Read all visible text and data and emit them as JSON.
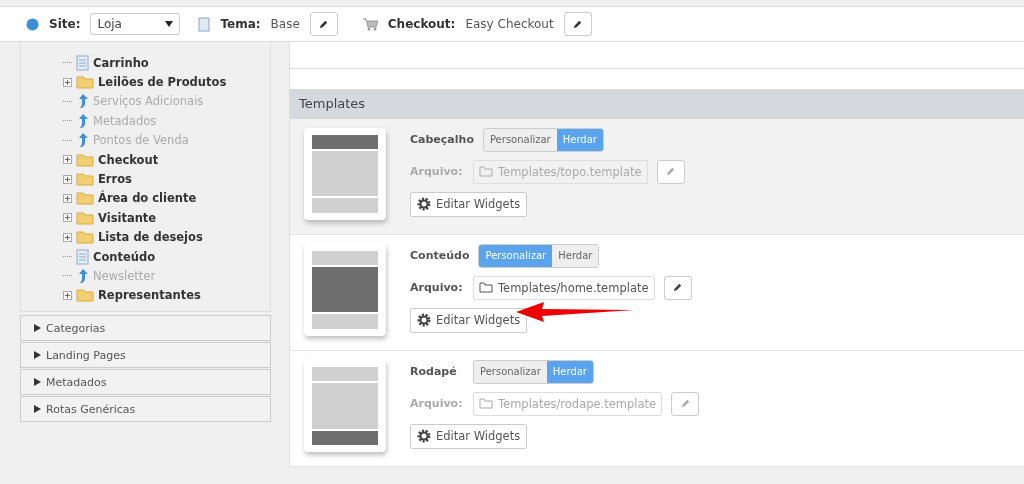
{
  "toolbar": {
    "site": {
      "label": "Site:",
      "value": "Loja"
    },
    "theme": {
      "label": "Tema:",
      "value": "Base"
    },
    "checkout": {
      "label": "Checkout:",
      "value": "Easy Checkout"
    }
  },
  "tree": [
    {
      "kind": "page",
      "label": "Carrinho",
      "disabled": false
    },
    {
      "kind": "folder",
      "label": "Leilões de Produtos",
      "disabled": false,
      "expanded": false
    },
    {
      "kind": "link",
      "label": "Serviços Adicionais",
      "disabled": true
    },
    {
      "kind": "link",
      "label": "Metadados",
      "disabled": true
    },
    {
      "kind": "link",
      "label": "Pontos de Venda",
      "disabled": true
    },
    {
      "kind": "folder",
      "label": "Checkout",
      "disabled": false,
      "expanded": false
    },
    {
      "kind": "folder",
      "label": "Erros",
      "disabled": false,
      "expanded": false
    },
    {
      "kind": "folder",
      "label": "Área do cliente",
      "disabled": false,
      "expanded": false
    },
    {
      "kind": "folder",
      "label": "Visitante",
      "disabled": false,
      "expanded": false
    },
    {
      "kind": "folder",
      "label": "Lista de desejos",
      "disabled": false,
      "expanded": false
    },
    {
      "kind": "page",
      "label": "Conteúdo",
      "disabled": false
    },
    {
      "kind": "link",
      "label": "Newsletter",
      "disabled": true
    },
    {
      "kind": "folder",
      "label": "Representantes",
      "disabled": false,
      "expanded": false
    }
  ],
  "accordions": [
    {
      "label": "Categorias",
      "expanded": false
    },
    {
      "label": "Landing Pages",
      "expanded": false
    },
    {
      "label": "Metadados",
      "expanded": false
    },
    {
      "label": "Rotas Genéricas",
      "expanded": false
    }
  ],
  "templates": {
    "title": "Templates",
    "items": [
      {
        "name": "Cabeçalho",
        "preview_blocks": [
          {
            "dark": true
          },
          {
            "dark": false
          },
          {
            "dark": false
          }
        ],
        "highlighted": true,
        "arrow": false,
        "options": [
          {
            "label": "Personalizar",
            "selected": false
          },
          {
            "label": "Herdar",
            "selected": true
          }
        ],
        "file_label": "Arquivo:",
        "file": "Templates/topo.template",
        "disabled": true,
        "button": "Editar Widgets"
      },
      {
        "name": "Conteúdo",
        "preview_blocks": [
          {
            "dark": false
          },
          {
            "dark": true
          },
          {
            "dark": false
          }
        ],
        "highlighted": false,
        "arrow": true,
        "options": [
          {
            "label": "Personalizar",
            "selected": true
          },
          {
            "label": "Herdar",
            "selected": false
          }
        ],
        "file_label": "Arquivo:",
        "file": "Templates/home.template",
        "disabled": false,
        "button": "Editar Widgets"
      },
      {
        "name": "Rodapé",
        "preview_blocks": [
          {
            "dark": false
          },
          {
            "dark": false
          },
          {
            "dark": true
          }
        ],
        "highlighted": false,
        "arrow": false,
        "options": [
          {
            "label": "Personalizar",
            "selected": false
          },
          {
            "label": "Herdar",
            "selected": true
          }
        ],
        "file_label": "Arquivo:",
        "file": "Templates/rodape.template",
        "disabled": true,
        "button": "Editar Widgets"
      }
    ]
  }
}
